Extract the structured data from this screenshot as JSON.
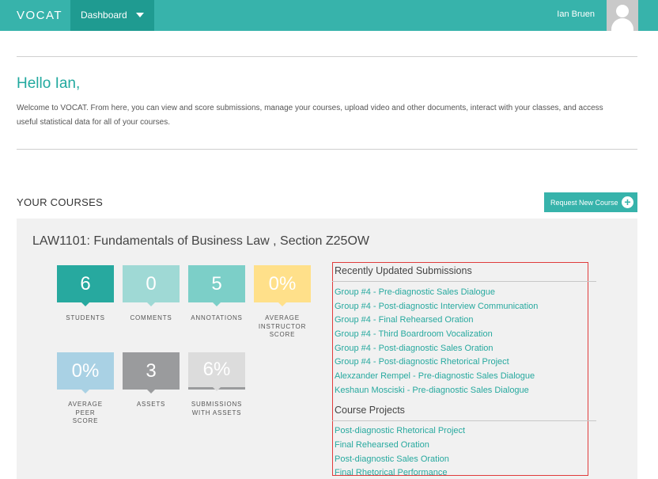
{
  "header": {
    "logo": "VOCAT",
    "nav_label": "Dashboard",
    "username": "Ian Bruen"
  },
  "greeting": {
    "title": "Hello Ian,",
    "welcome_text": "Welcome to VOCAT. From here, you can view and score submissions, manage your courses, upload video and other documents, interact with your classes, and access useful statistical data for all of your courses."
  },
  "courses": {
    "section_title": "YOUR COURSES",
    "request_button": "Request New Course",
    "course_title": "LAW1101: Fundamentals of Business Law , Section Z25OW",
    "stats": [
      {
        "value": "6",
        "label": "STUDENTS",
        "color": "#27a99f"
      },
      {
        "value": "0",
        "label": "COMMENTS",
        "color": "#9fd9d5"
      },
      {
        "value": "5",
        "label": "ANNOTATIONS",
        "color": "#7ccfc8"
      },
      {
        "value": "0%",
        "label": "AVERAGE INSTRUCTOR SCORE",
        "color": "#ffe08a"
      },
      {
        "value": "0%",
        "label": "AVERAGE PEER SCORE",
        "color": "#a9d1e4"
      },
      {
        "value": "3",
        "label": "ASSETS",
        "color": "#9a9b9d"
      },
      {
        "value": "6%",
        "label": "SUBMISSIONS WITH ASSETS",
        "color": "#dcdcdc"
      }
    ],
    "recent_submissions_title": "Recently Updated Submissions",
    "recent_submissions": [
      "Group #4 - Pre-diagnostic Sales Dialogue",
      "Group #4 - Post-diagnostic Interview Communication",
      "Group #4 - Final Rehearsed Oration",
      "Group #4 - Third Boardroom Vocalization",
      "Group #4 - Post-diagnostic Sales Oration",
      "Group #4 - Post-diagnostic Rhetorical Project",
      "Alexzander Rempel - Pre-diagnostic Sales Dialogue",
      "Keshaun Mosciski - Pre-diagnostic Sales Dialogue"
    ],
    "projects_title": "Course Projects",
    "projects": [
      "Post-diagnostic Rhetorical Project",
      "Final Rehearsed Oration",
      "Post-diagnostic Sales Oration",
      "Final Rhetorical Performance"
    ]
  }
}
